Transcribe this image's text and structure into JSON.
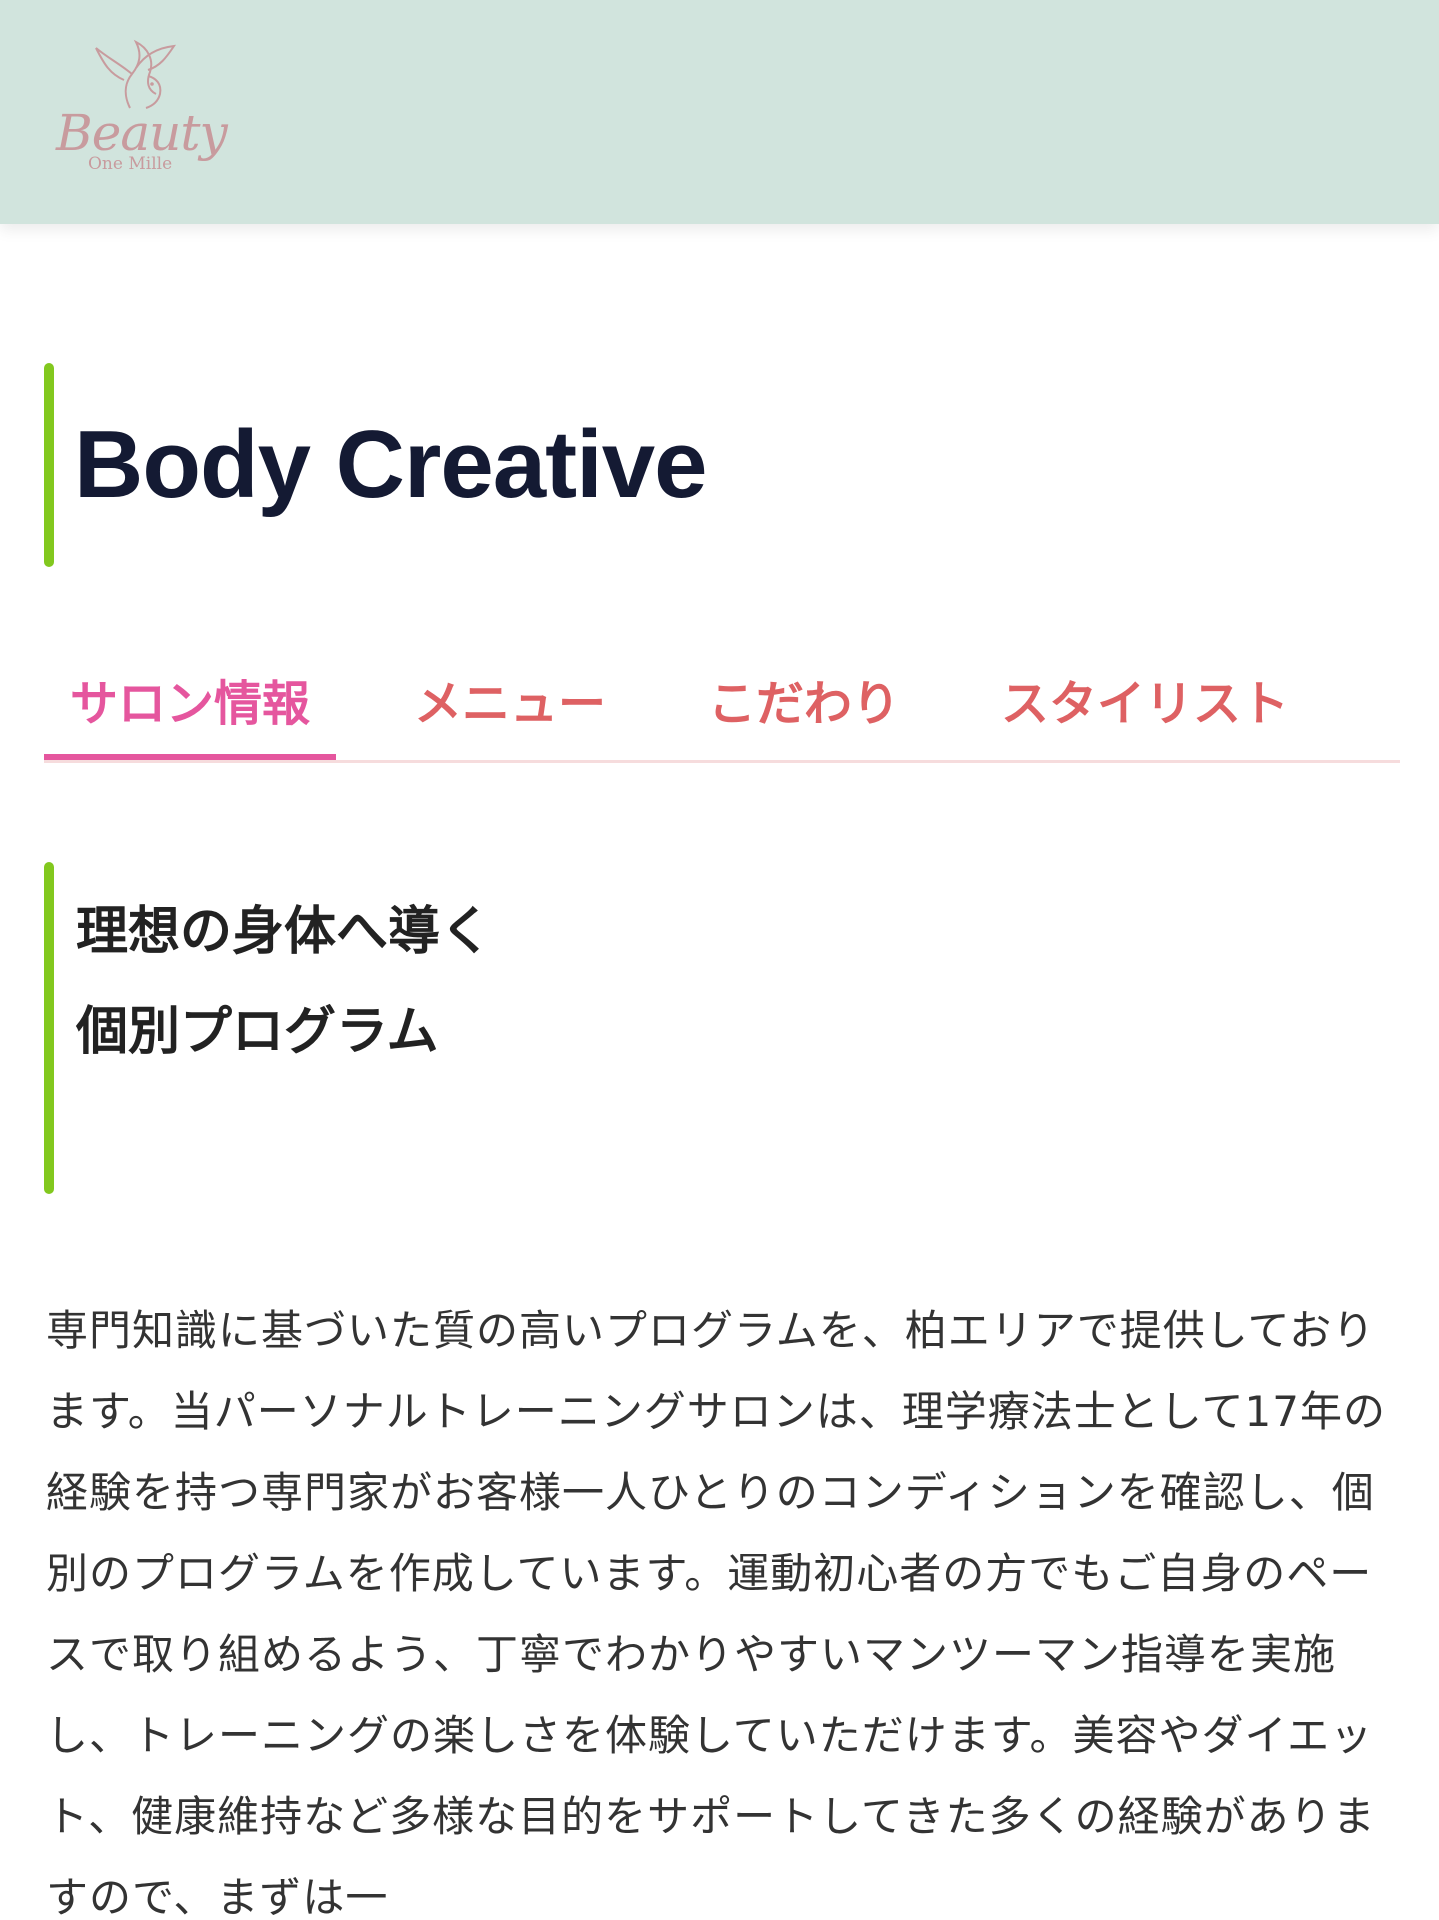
{
  "header": {
    "logo": {
      "wordmark": "Beauty",
      "tagline": "One Mille"
    }
  },
  "page": {
    "title": "Body Creative"
  },
  "tabs": [
    {
      "label": "サロン情報",
      "active": true
    },
    {
      "label": "メニュー",
      "active": false
    },
    {
      "label": "こだわり",
      "active": false
    },
    {
      "label": "スタイリスト",
      "active": false
    }
  ],
  "section": {
    "heading_line1": "理想の身体へ導く",
    "heading_line2": "個別プログラム",
    "body": "専門知識に基づいた質の高いプログラムを、柏エリアで提供しております。当パーソナルトレーニングサロンは、理学療法士として17年の経験を持つ専門家がお客様一人ひとりのコンディションを確認し、個別のプログラムを作成しています。運動初心者の方でもご自身のペースで取り組めるよう、丁寧でわかりやすいマンツーマン指導を実施し、トレーニングの楽しさを体験していただけます。美容やダイエット、健康維持など多様な目的をサポートしてきた多くの経験がありますので、まずは一"
  },
  "colors": {
    "header_bg": "#d1e4dd",
    "accent_green": "#82c81e",
    "tab_active": "#e5569e",
    "tab_inactive": "#de6163",
    "title_text": "#141a33"
  }
}
